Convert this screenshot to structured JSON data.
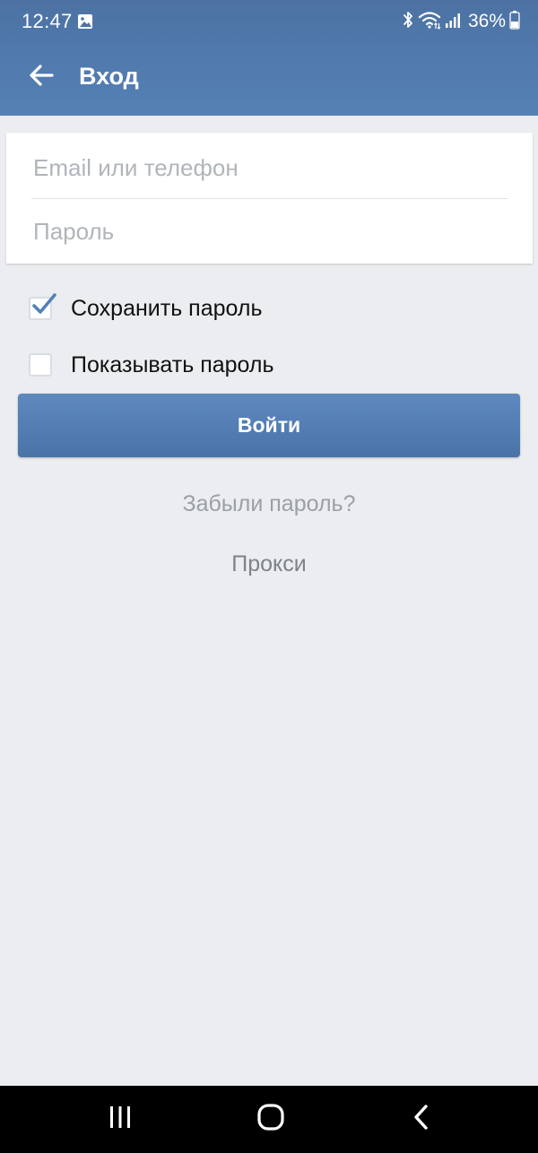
{
  "status_bar": {
    "time": "12:47",
    "battery": "36%"
  },
  "toolbar": {
    "title": "Вход"
  },
  "form": {
    "email_placeholder": "Email или телефон",
    "email_value": "",
    "password_placeholder": "Пароль",
    "password_value": ""
  },
  "options": {
    "save_password_label": "Сохранить пароль",
    "save_password_checked": true,
    "show_password_label": "Показывать пароль",
    "show_password_checked": false
  },
  "actions": {
    "login_label": "Войти",
    "forgot_password_label": "Забыли пароль?",
    "proxy_label": "Прокси"
  },
  "colors": {
    "app_bar": "#5181b8",
    "background": "#ebedf0",
    "button": "#5181b8",
    "link_text": "#9aa0a6"
  },
  "icons": {
    "toolbar": [
      "back-arrow-icon"
    ],
    "status": [
      "gallery-icon",
      "bluetooth-icon",
      "wifi-icon",
      "signal-icon",
      "battery-icon"
    ],
    "navigation": [
      "recents-icon",
      "home-icon",
      "back-icon"
    ]
  }
}
